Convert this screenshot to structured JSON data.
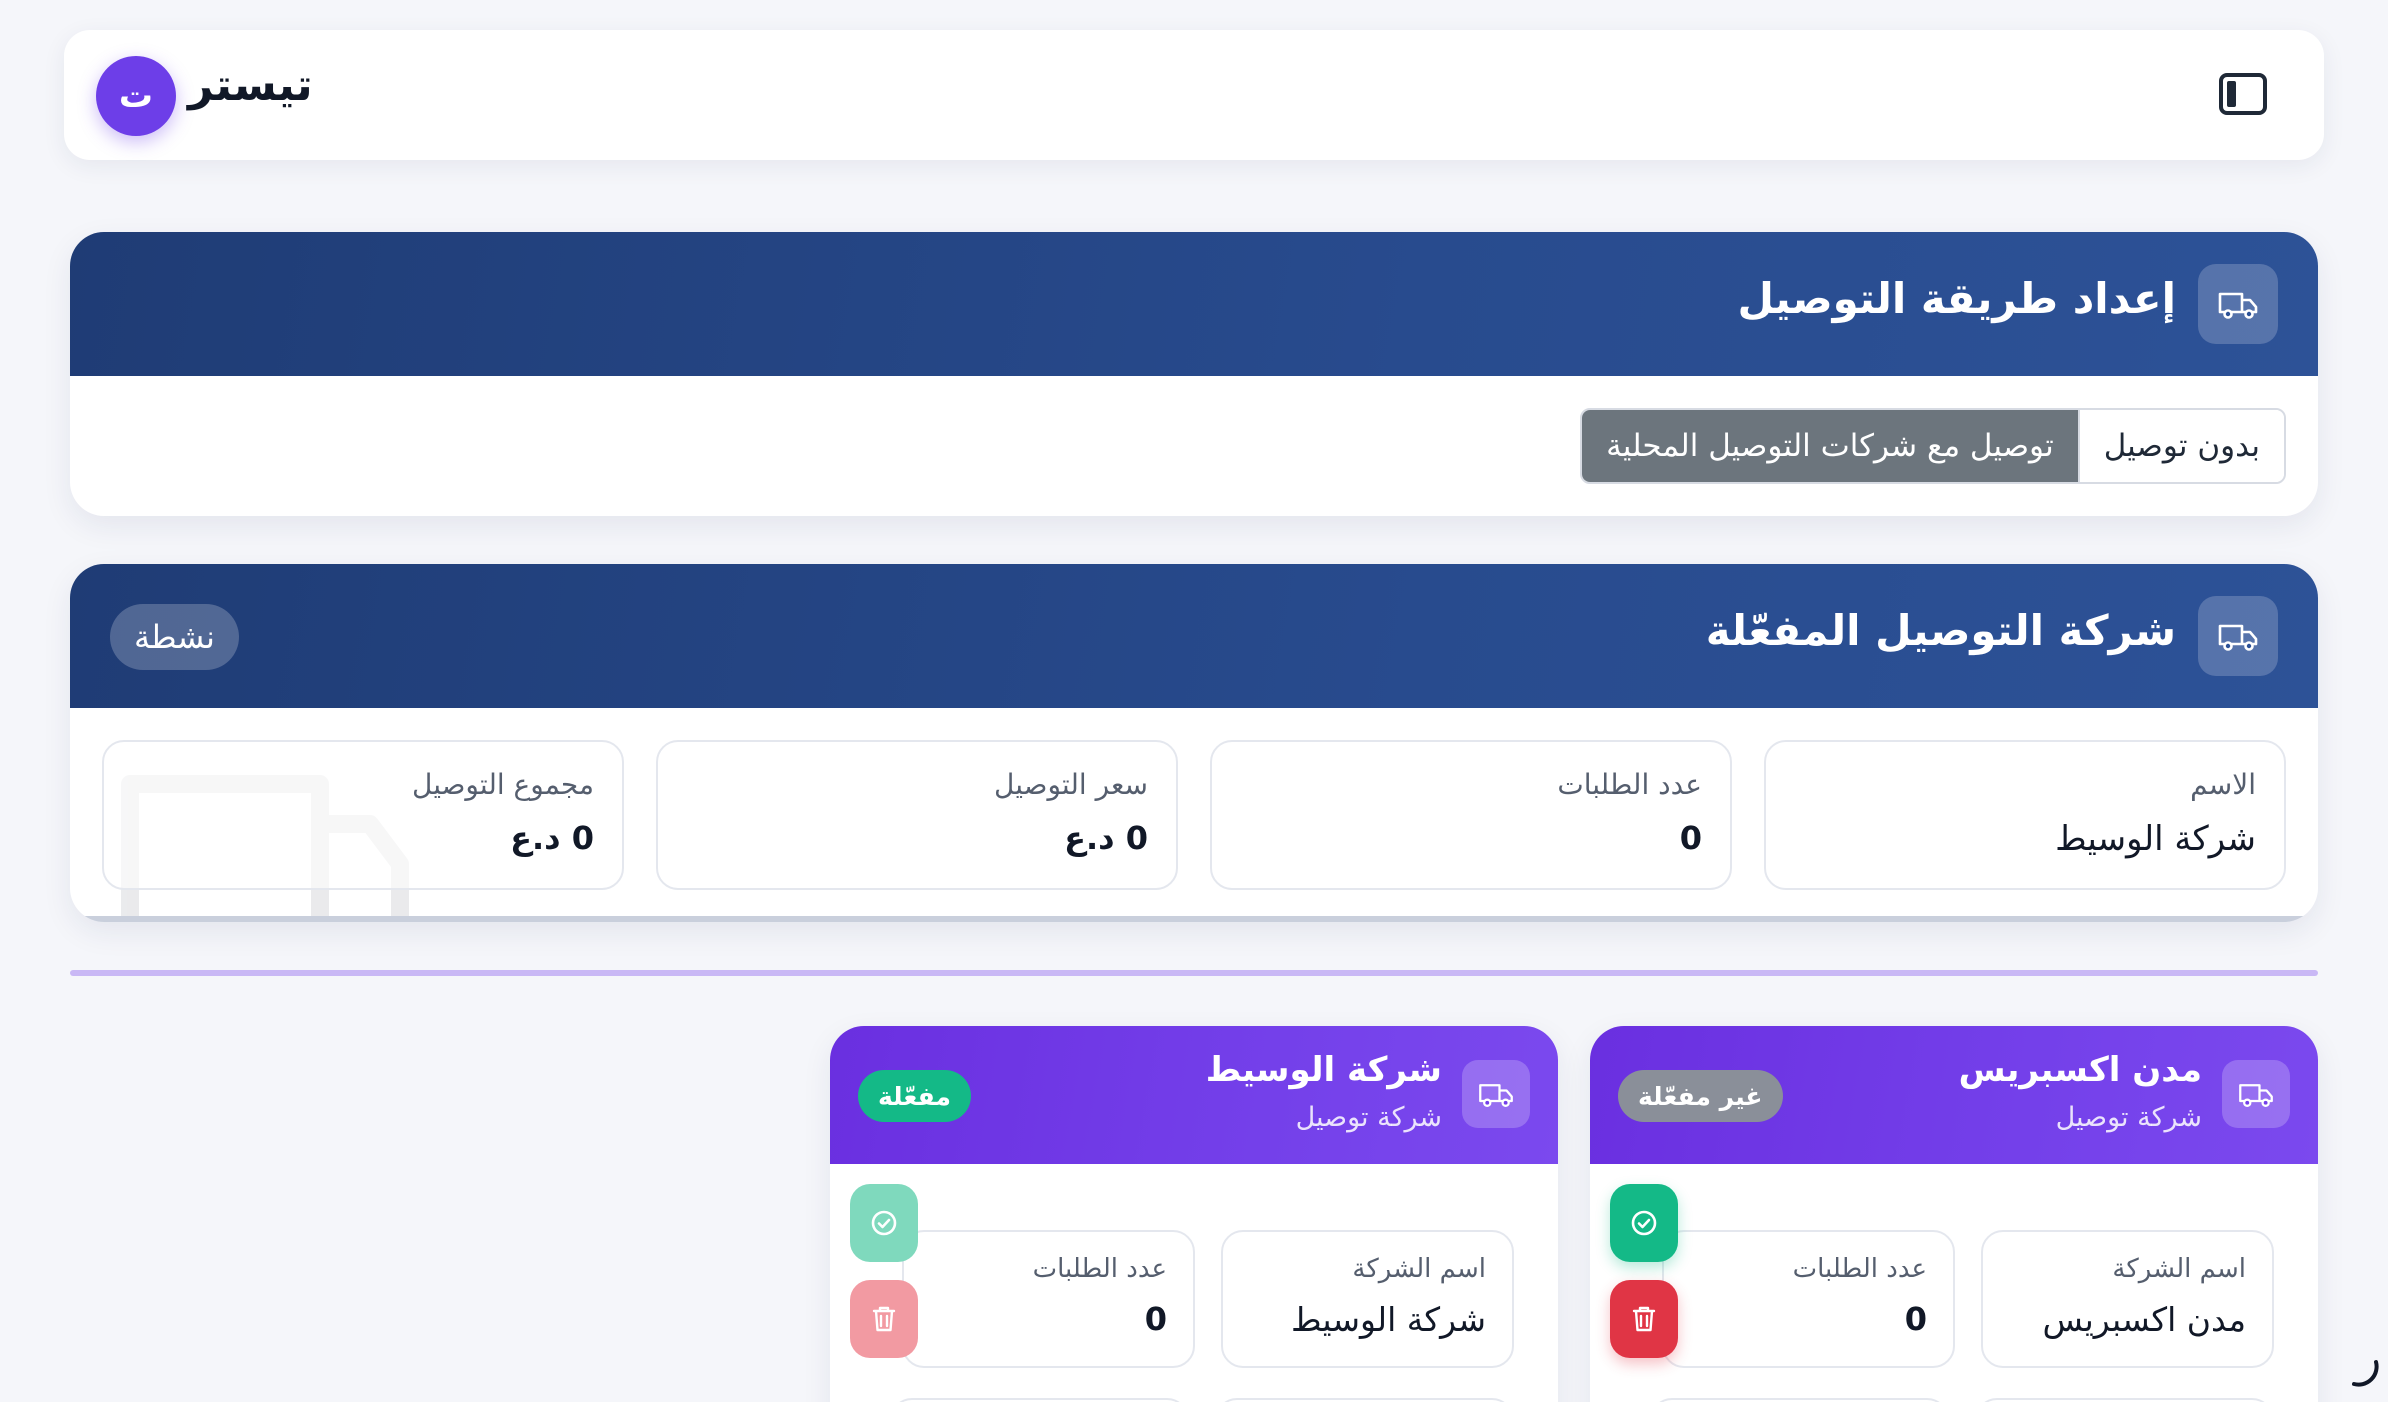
{
  "header": {
    "brand_initial": "ت",
    "brand_name": "تيستر"
  },
  "delivery_method": {
    "title": "إعداد طريقة التوصيل",
    "options": [
      "بدون توصيل",
      "توصيل مع شركات التوصيل المحلية"
    ],
    "selected": "توصيل مع شركات التوصيل المحلية"
  },
  "active_company": {
    "title": "شركة التوصيل المفعّلة",
    "status": "نشطة",
    "stats": [
      {
        "label": "الاسم",
        "value": "شركة الوسيط"
      },
      {
        "label": "عدد الطلبات",
        "value": "0"
      },
      {
        "label": "سعر التوصيل",
        "value": "0 د.ع"
      },
      {
        "label": "مجموع التوصيل",
        "value": "0 د.ع"
      }
    ]
  },
  "companies": [
    {
      "name": "مدن اكسبريس",
      "type": "شركة توصيل",
      "badge": "غير مفعّلة",
      "name_label": "اسم الشركة",
      "name_value": "مدن اكسبريس",
      "orders_label": "عدد الطلبات",
      "orders_value": "0"
    },
    {
      "name": "شركة الوسيط",
      "type": "شركة توصيل",
      "badge": "مفعّلة",
      "name_label": "اسم الشركة",
      "name_value": "شركة الوسيط",
      "orders_label": "عدد الطلبات",
      "orders_value": "0"
    }
  ],
  "icons": {
    "sidebar_toggle": "sidebar-toggle-icon",
    "truck": "truck-icon",
    "check": "check-circle-icon",
    "trash": "trash-icon"
  },
  "colors": {
    "primary_purple": "#6d3ee8",
    "header_blue": "#284b8e",
    "success": "#14b987",
    "danger": "#e03545",
    "muted": "#6c757d"
  }
}
